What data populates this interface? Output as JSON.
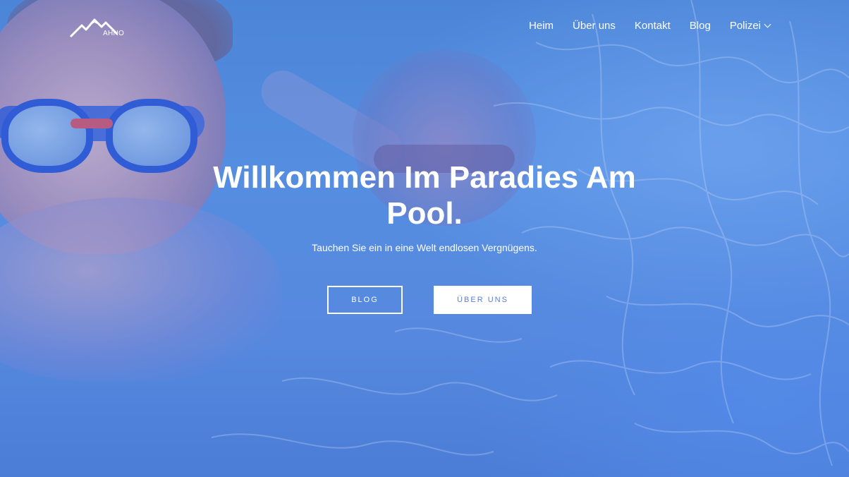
{
  "logo": {
    "text": "AHNO",
    "icon": "mountain-logo-icon"
  },
  "nav": {
    "items": [
      {
        "label": "Heim"
      },
      {
        "label": "Über uns"
      },
      {
        "label": "Kontakt"
      },
      {
        "label": "Blog"
      },
      {
        "label": "Polizei",
        "icon": "chevron-down-icon"
      }
    ]
  },
  "hero": {
    "title": "Willkommen Im Paradies Am Pool.",
    "subtitle": "Tauchen Sie ein in eine Welt endlosen Vergnügens.",
    "buttons": {
      "primary_label": "BLOG",
      "secondary_label": "ÜBER UNS"
    }
  },
  "colors": {
    "overlay": "#4f8ad8",
    "button_text": "#5a7fd8",
    "text": "#ffffff"
  }
}
